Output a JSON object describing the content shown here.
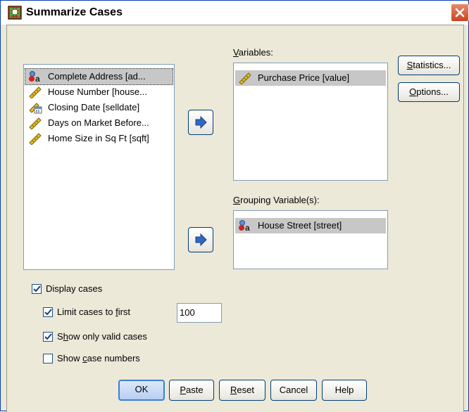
{
  "window": {
    "title": "Summarize Cases"
  },
  "source_list": {
    "items": [
      {
        "label": "Complete Address [ad...",
        "icon": "nominal-string-icon"
      },
      {
        "label": "House Number [house...",
        "icon": "scale-ruler-icon"
      },
      {
        "label": "Closing Date [selldate]",
        "icon": "date-scale-icon"
      },
      {
        "label": "Days on Market Before...",
        "icon": "scale-ruler-icon"
      },
      {
        "label": "Home Size in Sq Ft [sqft]",
        "icon": "scale-ruler-icon"
      }
    ]
  },
  "variables": {
    "label": "Variables:",
    "items": [
      {
        "label": "Purchase Price [value]",
        "icon": "scale-ruler-icon"
      }
    ]
  },
  "grouping": {
    "label": "Grouping Variable(s):",
    "items": [
      {
        "label": "House Street [street]",
        "icon": "nominal-string-icon"
      }
    ]
  },
  "side_buttons": {
    "statistics": "Statistics...",
    "options": "Options..."
  },
  "options": {
    "display_cases": {
      "label": "Display cases",
      "checked": true
    },
    "limit_cases": {
      "label": "Limit cases to first",
      "checked": true,
      "value": "100"
    },
    "show_valid": {
      "label": "Show only valid cases",
      "checked": true
    },
    "show_numbers": {
      "label": "Show case numbers",
      "checked": false
    }
  },
  "bottom_buttons": {
    "ok": "OK",
    "paste": "Paste",
    "reset": "Reset",
    "cancel": "Cancel",
    "help": "Help"
  },
  "colors": {
    "dialog_bg": "#ece9d8",
    "selection": "#c7c7c7",
    "border_blue": "#7f9db9"
  }
}
